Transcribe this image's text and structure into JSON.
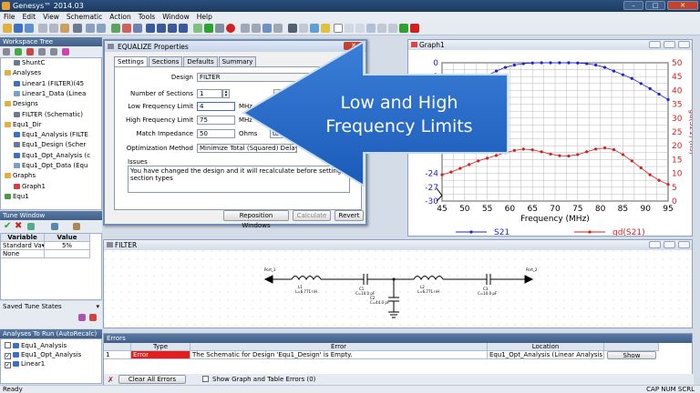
{
  "window": {
    "title": "Genesys™ 2014.03"
  },
  "menu": [
    "File",
    "Edit",
    "View",
    "Schematic",
    "Action",
    "Tools",
    "Window",
    "Help"
  ],
  "workspace": {
    "title": "Workspace Tree",
    "items": [
      {
        "label": "ShuntC",
        "indent": 1,
        "icon": "schematic-icon"
      },
      {
        "label": "Analyses",
        "indent": 0,
        "icon": "folder-icon"
      },
      {
        "label": "Linear1 (FILTER)(45",
        "indent": 1,
        "icon": "analysis-icon"
      },
      {
        "label": "Linear1_Data (Linea",
        "indent": 1,
        "icon": "data-icon"
      },
      {
        "label": "Designs",
        "indent": 0,
        "icon": "folder-icon"
      },
      {
        "label": "FILTER (Schematic)",
        "indent": 1,
        "icon": "schematic-icon"
      },
      {
        "label": "Equ1_Dir",
        "indent": 0,
        "icon": "folder-icon"
      },
      {
        "label": "Equ1_Analysis (FILTE",
        "indent": 1,
        "icon": "analysis-icon"
      },
      {
        "label": "Equ1_Design (Scher",
        "indent": 1,
        "icon": "schematic-icon"
      },
      {
        "label": "Equ1_Opt_Analysis (c",
        "indent": 1,
        "icon": "analysis-icon"
      },
      {
        "label": "Equ1_Opt_Data (Equ",
        "indent": 1,
        "icon": "data-icon"
      },
      {
        "label": "Graphs",
        "indent": 0,
        "icon": "folder-icon"
      },
      {
        "label": "Graph1",
        "indent": 1,
        "icon": "graph-icon"
      },
      {
        "label": "Equ1",
        "indent": 0,
        "icon": "equation-icon"
      }
    ]
  },
  "tune": {
    "title": "Tune Window",
    "headers": [
      "Variable",
      "Value"
    ],
    "rows": [
      [
        "Standard Va",
        "5%"
      ],
      [
        "None",
        ""
      ]
    ]
  },
  "saved_tune": {
    "title": "Saved Tune States"
  },
  "analyses_run": {
    "title": "Analyses To Run (AutoRecalc)",
    "items": [
      {
        "label": "Equ1_Analysis",
        "checked": false
      },
      {
        "label": "Equ1_Opt_Analysis",
        "checked": true
      },
      {
        "label": "Linear1",
        "checked": true
      }
    ]
  },
  "dialog": {
    "title": "EQUALIZE Properties",
    "tabs": [
      "Settings",
      "Sections",
      "Defaults",
      "Summary"
    ],
    "design_label": "Design",
    "design_value": "FILTER",
    "sections_label": "Number of Sections",
    "sections_value": "1",
    "low_label": "Low Frequency Limit",
    "low_value": "4",
    "low_unit": "MHz",
    "high_label": "High Frequency Limit",
    "high_value": "75",
    "high_unit": "MHz",
    "impedance_label": "Match Impedance",
    "impedance_value": "50",
    "impedance_unit": "Ohms",
    "impedance_extra": "tota",
    "opt_label": "Optimization Method",
    "opt_value": "Minimize Total (Squared) Delay",
    "issues_label": "Issues",
    "issues_text": "You have changed the design and it will recalculate before setting section types",
    "btn_reposition": "Reposition Windows",
    "btn_calculate": "Calculate",
    "btn_revert": "Revert"
  },
  "callout": {
    "line1": "Low and High",
    "line2": "Frequency Limits"
  },
  "graph": {
    "title": "Graph1",
    "legend": [
      {
        "name": "S21",
        "color": "#1f1fd6"
      },
      {
        "name": "gd(S21)",
        "color": "#d42020"
      }
    ]
  },
  "chart_data": {
    "type": "line",
    "xlabel": "Frequency (MHz)",
    "ylabel_right": "gd(S21) (ns)",
    "xlim": [
      45,
      95
    ],
    "xticks": [
      45,
      50,
      55,
      60,
      65,
      70,
      75,
      80,
      85,
      90,
      95
    ],
    "ylim_left": [
      -30,
      0
    ],
    "yticks_left": [
      0,
      -3,
      -6,
      -24,
      -27,
      -30
    ],
    "ylim_right": [
      0,
      50
    ],
    "yticks_right": [
      50,
      45,
      40,
      35,
      30,
      25,
      20,
      15,
      10,
      5,
      0
    ],
    "series": [
      {
        "name": "S21",
        "axis": "left",
        "color": "#1f1fd6",
        "x": [
          45,
          47,
          49,
          51,
          53,
          55,
          57,
          59,
          61,
          63,
          65,
          67,
          69,
          71,
          73,
          75,
          77,
          79,
          81,
          83,
          85,
          87,
          89,
          91,
          93,
          95
        ],
        "y": [
          -10.5,
          -9.0,
          -7.5,
          -5.8,
          -4.2,
          -2.8,
          -1.8,
          -1.0,
          -0.5,
          -0.2,
          -0.05,
          0,
          0,
          0,
          0,
          -0.05,
          -0.2,
          -0.5,
          -1.0,
          -1.8,
          -2.6,
          -3.4,
          -4.5,
          -5.6,
          -6.8,
          -8.0
        ]
      },
      {
        "name": "gd(S21)",
        "axis": "right",
        "color": "#d42020",
        "x": [
          45,
          47,
          49,
          51,
          53,
          55,
          57,
          59,
          61,
          63,
          65,
          67,
          69,
          71,
          73,
          75,
          77,
          79,
          81,
          83,
          85,
          87,
          89,
          91,
          93,
          95
        ],
        "y": [
          9.5,
          10.5,
          11.8,
          13.2,
          14.5,
          15.5,
          16.5,
          17.5,
          18.3,
          18.8,
          18.5,
          17.8,
          17.0,
          16.4,
          16.3,
          16.8,
          17.8,
          18.8,
          19.2,
          18.6,
          16.8,
          14.5,
          12.0,
          9.5,
          7.5,
          6.0
        ]
      }
    ]
  },
  "filter": {
    "title": "FILTER",
    "port1": "Port_1",
    "port2": "Port_2",
    "l1": "L1",
    "l1v": "L=6.771 nH",
    "c1": "C1",
    "c1v": "C=10.0 pF",
    "l2": "L2",
    "l2v": "L=6.771 nH",
    "c2": "C2",
    "c2v": "C=44.0 pF",
    "c3": "C3",
    "c3v": "C=10.0 pF"
  },
  "errors": {
    "title": "Errors",
    "headers": [
      "Type",
      "Error",
      "Location"
    ],
    "row": {
      "num": "1",
      "type": "Error",
      "error": "The Schematic for Design 'Equ1_Design' is Empty.",
      "location": "Equ1_Opt_Analysis (Linear Analysis)",
      "action": "Show"
    },
    "clear_label": "Clear All Errors",
    "show_graph_label": "Show Graph and Table Errors (0)"
  },
  "status": {
    "left": "Ready",
    "right": "CAP  NUM  SCRL"
  }
}
